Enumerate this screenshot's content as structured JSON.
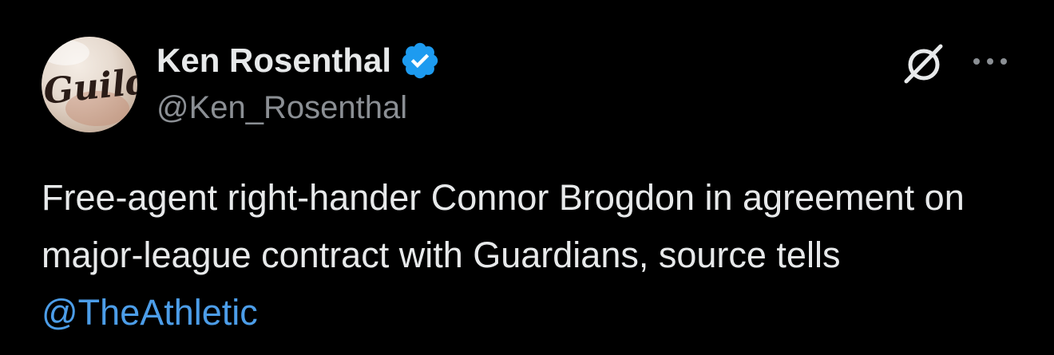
{
  "tweet": {
    "author": {
      "display_name": "Ken Rosenthal",
      "handle": "@Ken_Rosenthal",
      "verified": true,
      "avatar_text": "Guild"
    },
    "text_before_mention": "Free-agent right-hander Connor Brogdon in agreement on major-league contract with Guardians, source tells ",
    "mention": "@TheAthletic"
  },
  "icons": {
    "verified": "verified-badge-icon",
    "grok": "grok-icon",
    "more": "more-options-icon"
  },
  "colors": {
    "background": "#000000",
    "text": "#e7e9ea",
    "secondary_text": "#8b8f94",
    "link": "#4c9de8",
    "verified_badge": "#1d9bf0"
  }
}
